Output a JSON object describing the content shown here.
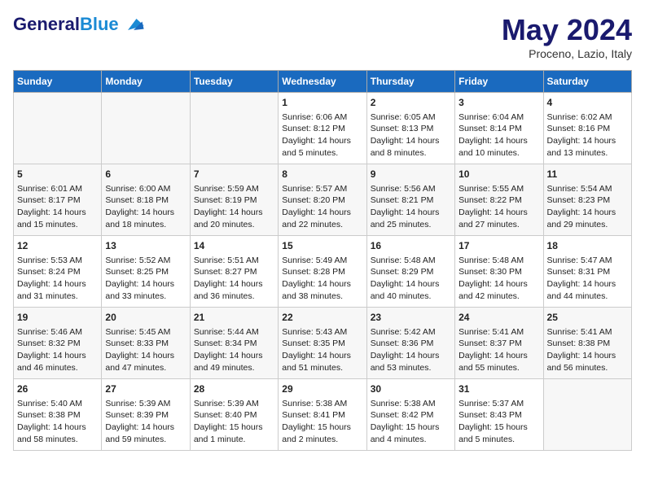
{
  "header": {
    "logo_general": "General",
    "logo_blue": "Blue",
    "month_title": "May 2024",
    "location": "Proceno, Lazio, Italy"
  },
  "days_of_week": [
    "Sunday",
    "Monday",
    "Tuesday",
    "Wednesday",
    "Thursday",
    "Friday",
    "Saturday"
  ],
  "weeks": [
    [
      {
        "day": "",
        "info": ""
      },
      {
        "day": "",
        "info": ""
      },
      {
        "day": "",
        "info": ""
      },
      {
        "day": "1",
        "info": "Sunrise: 6:06 AM\nSunset: 8:12 PM\nDaylight: 14 hours\nand 5 minutes."
      },
      {
        "day": "2",
        "info": "Sunrise: 6:05 AM\nSunset: 8:13 PM\nDaylight: 14 hours\nand 8 minutes."
      },
      {
        "day": "3",
        "info": "Sunrise: 6:04 AM\nSunset: 8:14 PM\nDaylight: 14 hours\nand 10 minutes."
      },
      {
        "day": "4",
        "info": "Sunrise: 6:02 AM\nSunset: 8:16 PM\nDaylight: 14 hours\nand 13 minutes."
      }
    ],
    [
      {
        "day": "5",
        "info": "Sunrise: 6:01 AM\nSunset: 8:17 PM\nDaylight: 14 hours\nand 15 minutes."
      },
      {
        "day": "6",
        "info": "Sunrise: 6:00 AM\nSunset: 8:18 PM\nDaylight: 14 hours\nand 18 minutes."
      },
      {
        "day": "7",
        "info": "Sunrise: 5:59 AM\nSunset: 8:19 PM\nDaylight: 14 hours\nand 20 minutes."
      },
      {
        "day": "8",
        "info": "Sunrise: 5:57 AM\nSunset: 8:20 PM\nDaylight: 14 hours\nand 22 minutes."
      },
      {
        "day": "9",
        "info": "Sunrise: 5:56 AM\nSunset: 8:21 PM\nDaylight: 14 hours\nand 25 minutes."
      },
      {
        "day": "10",
        "info": "Sunrise: 5:55 AM\nSunset: 8:22 PM\nDaylight: 14 hours\nand 27 minutes."
      },
      {
        "day": "11",
        "info": "Sunrise: 5:54 AM\nSunset: 8:23 PM\nDaylight: 14 hours\nand 29 minutes."
      }
    ],
    [
      {
        "day": "12",
        "info": "Sunrise: 5:53 AM\nSunset: 8:24 PM\nDaylight: 14 hours\nand 31 minutes."
      },
      {
        "day": "13",
        "info": "Sunrise: 5:52 AM\nSunset: 8:25 PM\nDaylight: 14 hours\nand 33 minutes."
      },
      {
        "day": "14",
        "info": "Sunrise: 5:51 AM\nSunset: 8:27 PM\nDaylight: 14 hours\nand 36 minutes."
      },
      {
        "day": "15",
        "info": "Sunrise: 5:49 AM\nSunset: 8:28 PM\nDaylight: 14 hours\nand 38 minutes."
      },
      {
        "day": "16",
        "info": "Sunrise: 5:48 AM\nSunset: 8:29 PM\nDaylight: 14 hours\nand 40 minutes."
      },
      {
        "day": "17",
        "info": "Sunrise: 5:48 AM\nSunset: 8:30 PM\nDaylight: 14 hours\nand 42 minutes."
      },
      {
        "day": "18",
        "info": "Sunrise: 5:47 AM\nSunset: 8:31 PM\nDaylight: 14 hours\nand 44 minutes."
      }
    ],
    [
      {
        "day": "19",
        "info": "Sunrise: 5:46 AM\nSunset: 8:32 PM\nDaylight: 14 hours\nand 46 minutes."
      },
      {
        "day": "20",
        "info": "Sunrise: 5:45 AM\nSunset: 8:33 PM\nDaylight: 14 hours\nand 47 minutes."
      },
      {
        "day": "21",
        "info": "Sunrise: 5:44 AM\nSunset: 8:34 PM\nDaylight: 14 hours\nand 49 minutes."
      },
      {
        "day": "22",
        "info": "Sunrise: 5:43 AM\nSunset: 8:35 PM\nDaylight: 14 hours\nand 51 minutes."
      },
      {
        "day": "23",
        "info": "Sunrise: 5:42 AM\nSunset: 8:36 PM\nDaylight: 14 hours\nand 53 minutes."
      },
      {
        "day": "24",
        "info": "Sunrise: 5:41 AM\nSunset: 8:37 PM\nDaylight: 14 hours\nand 55 minutes."
      },
      {
        "day": "25",
        "info": "Sunrise: 5:41 AM\nSunset: 8:38 PM\nDaylight: 14 hours\nand 56 minutes."
      }
    ],
    [
      {
        "day": "26",
        "info": "Sunrise: 5:40 AM\nSunset: 8:38 PM\nDaylight: 14 hours\nand 58 minutes."
      },
      {
        "day": "27",
        "info": "Sunrise: 5:39 AM\nSunset: 8:39 PM\nDaylight: 14 hours\nand 59 minutes."
      },
      {
        "day": "28",
        "info": "Sunrise: 5:39 AM\nSunset: 8:40 PM\nDaylight: 15 hours\nand 1 minute."
      },
      {
        "day": "29",
        "info": "Sunrise: 5:38 AM\nSunset: 8:41 PM\nDaylight: 15 hours\nand 2 minutes."
      },
      {
        "day": "30",
        "info": "Sunrise: 5:38 AM\nSunset: 8:42 PM\nDaylight: 15 hours\nand 4 minutes."
      },
      {
        "day": "31",
        "info": "Sunrise: 5:37 AM\nSunset: 8:43 PM\nDaylight: 15 hours\nand 5 minutes."
      },
      {
        "day": "",
        "info": ""
      }
    ]
  ]
}
